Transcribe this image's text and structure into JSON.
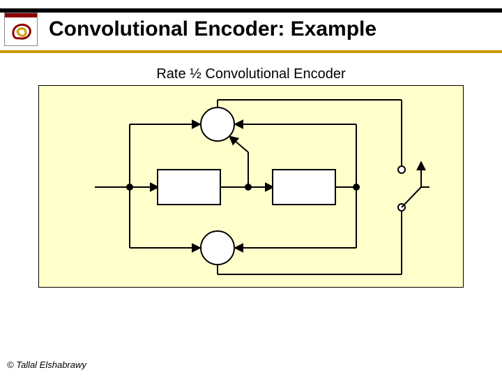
{
  "title": "Convolutional Encoder: Example",
  "subtitle": "Rate ½ Convolutional Encoder",
  "footer": "© Tallal Elshabrawy",
  "diagram": {
    "description": "Rate 1/2 convolutional encoder with two shift-register stages and two XOR adders feeding a 2:1 output switch",
    "accent_box": "#ffffcc"
  }
}
